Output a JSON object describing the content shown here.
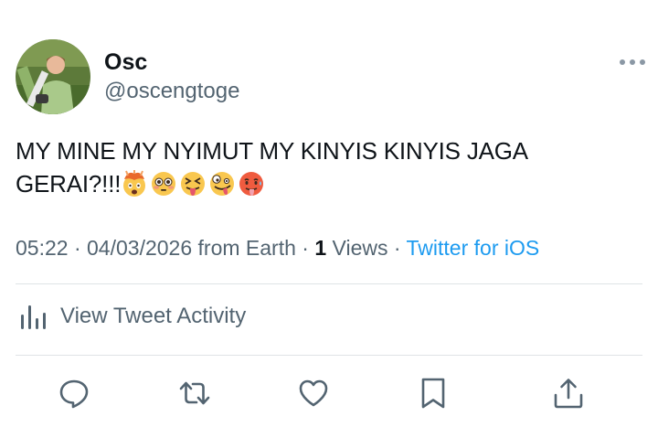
{
  "tweet": {
    "author": {
      "display_name": "Osc",
      "handle": "@oscengtoge"
    },
    "text": "MY MINE MY NYIMUT MY KINYIS KINYIS JAGA GERAI?!!!",
    "emojis": [
      "exploding-head",
      "flushed-face",
      "squinting-tongue-face",
      "zany-face",
      "hot-face"
    ],
    "time": "05:22",
    "date": "04/03/2026",
    "location_prefix": "from",
    "location": "Earth",
    "views_count": "1",
    "views_label": "Views",
    "source": "Twitter for iOS",
    "separator": "·"
  },
  "activity": {
    "label": "View Tweet Activity",
    "icon": "bar-chart-icon"
  },
  "actions": [
    {
      "name": "reply",
      "icon": "speech-bubble-icon"
    },
    {
      "name": "retweet",
      "icon": "retweet-arrows-icon"
    },
    {
      "name": "like",
      "icon": "heart-icon"
    },
    {
      "name": "bookmark",
      "icon": "bookmark-icon"
    },
    {
      "name": "share",
      "icon": "share-upload-icon"
    }
  ],
  "colors": {
    "text": "#0f1419",
    "secondary": "#536471",
    "link": "#1d9bf0",
    "divider": "#dfe3e6"
  }
}
